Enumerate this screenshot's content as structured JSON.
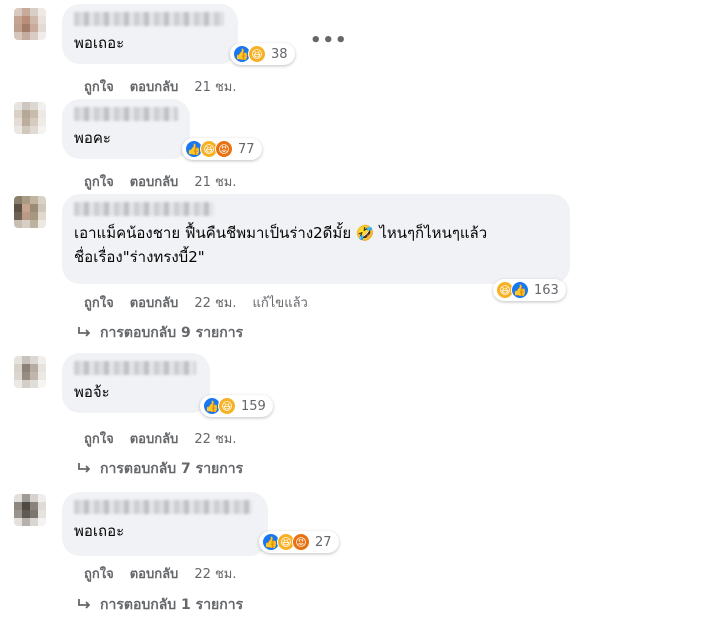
{
  "comments": [
    {
      "text": "พอเถอะ",
      "reaction_count": "38",
      "reactions": [
        "like",
        "haha"
      ],
      "actions": {
        "like": "ถูกใจ",
        "reply": "ตอบกลับ",
        "time": "21 ชม."
      }
    },
    {
      "text": "พอคะ",
      "reaction_count": "77",
      "reactions": [
        "like",
        "haha",
        "angry"
      ],
      "actions": {
        "like": "ถูกใจ",
        "reply": "ตอบกลับ",
        "time": "21 ชม."
      }
    },
    {
      "text_line1": "เอาแม็คน้องชาย ฟื้นคืนชีพมาเป็นร่าง2ดีมั้ย 🤣 ไหนๆก็ไหนๆแล้ว",
      "text_line2": "ชื่อเรื่อง\"ร่างทรงบี้2\"",
      "reaction_count": "163",
      "reactions": [
        "haha",
        "like"
      ],
      "actions": {
        "like": "ถูกใจ",
        "reply": "ตอบกลับ",
        "time": "22 ชม.",
        "edited": "แก้ไขแล้ว"
      },
      "replies_label": "การตอบกลับ 9 รายการ"
    },
    {
      "text": "พอจ้ะ",
      "reaction_count": "159",
      "reactions": [
        "like",
        "haha"
      ],
      "actions": {
        "like": "ถูกใจ",
        "reply": "ตอบกลับ",
        "time": "22 ชม."
      },
      "replies_label": "การตอบกลับ 7 รายการ"
    },
    {
      "text": "พอเถอะ",
      "reaction_count": "27",
      "reactions": [
        "like",
        "haha",
        "angry"
      ],
      "actions": {
        "like": "ถูกใจ",
        "reply": "ตอบกลับ",
        "time": "22 ชม."
      },
      "replies_label": "การตอบกลับ 1 รายการ"
    }
  ],
  "more_options": "•••",
  "colors": {
    "like": "#1877f2",
    "haha": "#f7b125",
    "angry": "#e9710f",
    "bubble": "#f0f2f5",
    "meta": "#65676b"
  }
}
